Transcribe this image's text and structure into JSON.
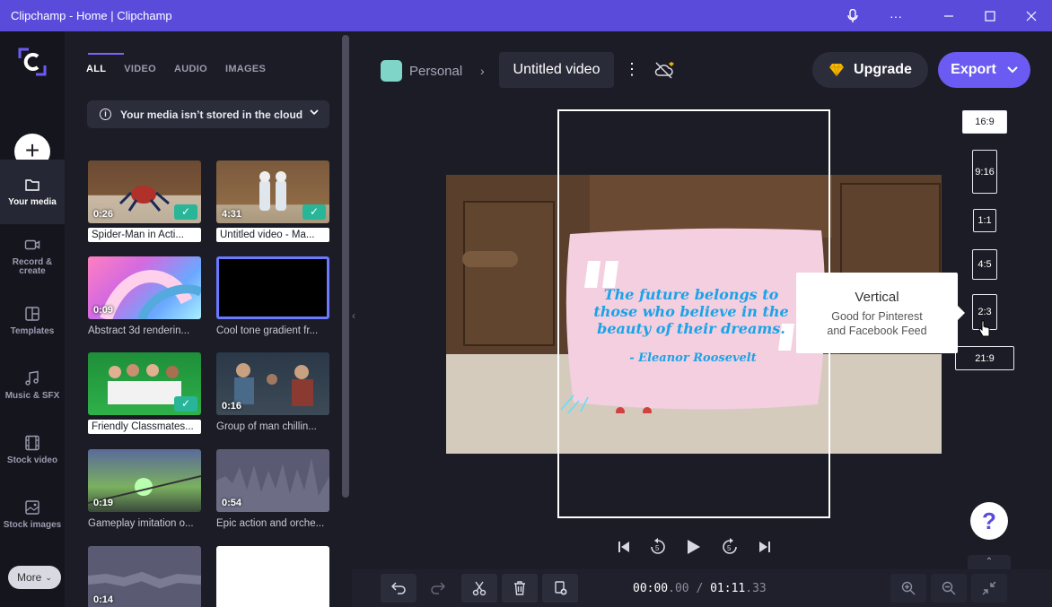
{
  "window": {
    "title": "Clipchamp - Home | Clipchamp"
  },
  "colors": {
    "accent": "#5b4bdb",
    "export": "#6c5bf2",
    "check": "#29b597",
    "quote": "#1ba3e8"
  },
  "rail": {
    "items": [
      {
        "label": "Your media",
        "icon": "folder-icon"
      },
      {
        "label": "Record & create",
        "icon": "camera-icon"
      },
      {
        "label": "Templates",
        "icon": "templates-icon"
      },
      {
        "label": "Music & SFX",
        "icon": "music-note-icon"
      },
      {
        "label": "Stock video",
        "icon": "film-icon"
      },
      {
        "label": "Stock images",
        "icon": "image-icon"
      }
    ],
    "more_label": "More"
  },
  "media": {
    "tabs": [
      "ALL",
      "VIDEO",
      "AUDIO",
      "IMAGES"
    ],
    "cloud_notice": "Your media isn’t stored in the cloud",
    "items": [
      {
        "duration": "0:26",
        "label": "Spider-Man in Acti...",
        "checked": true,
        "selected": true
      },
      {
        "duration": "4:31",
        "label": "Untitled video - Ma...",
        "checked": true,
        "selected": true
      },
      {
        "duration": "0:09",
        "label": "Abstract 3d renderin...",
        "checked": false,
        "selected": false
      },
      {
        "duration": "",
        "label": "Cool tone gradient fr...",
        "checked": false,
        "selected": false
      },
      {
        "duration": "",
        "label": "Friendly Classmates...",
        "checked": true,
        "selected": true
      },
      {
        "duration": "0:16",
        "label": "Group of man chillin...",
        "checked": false,
        "selected": false
      },
      {
        "duration": "0:19",
        "label": "Gameplay imitation o...",
        "checked": false,
        "selected": false
      },
      {
        "duration": "0:54",
        "label": "Epic action and orche...",
        "checked": false,
        "selected": false
      },
      {
        "duration": "0:14",
        "label": "",
        "checked": false,
        "selected": false
      },
      {
        "duration": "",
        "label": "",
        "checked": false,
        "selected": false
      }
    ]
  },
  "header": {
    "workspace": "Personal",
    "project_title": "Untitled video",
    "upgrade_label": "Upgrade",
    "export_label": "Export"
  },
  "preview": {
    "quote": "The future belongs to those who believe in the beauty of their dreams.",
    "author": "- Eleanor Roosevelt"
  },
  "aspect_ratios": [
    "16:9",
    "9:16",
    "1:1",
    "4:5",
    "2:3",
    "21:9"
  ],
  "selected_ratio": "16:9",
  "tooltip": {
    "title": "Vertical",
    "body": "Good for Pinterest and Facebook Feed"
  },
  "help_label": "?",
  "timecode": {
    "current": "00:00",
    "current_frac": ".00",
    "separator": " / ",
    "total": "01:11",
    "total_frac": ".33"
  }
}
